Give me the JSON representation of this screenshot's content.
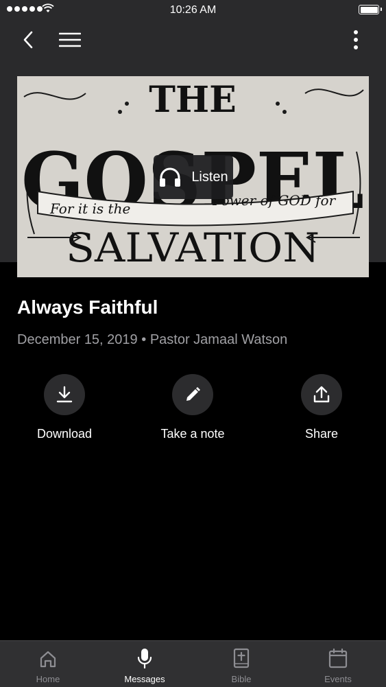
{
  "status_bar": {
    "time": "10:26 AM"
  },
  "artwork": {
    "lines": [
      "THE",
      "GOSPEL",
      "SALVATION"
    ],
    "banner_left": "For it is the",
    "banner_right": "Power of GOD for"
  },
  "listen_button": {
    "label": "Listen"
  },
  "message": {
    "title": "Always Faithful",
    "date": "December 15, 2019",
    "separator": "•",
    "speaker": "Pastor Jamaal Watson"
  },
  "actions": [
    {
      "label": "Download",
      "icon": "download-icon"
    },
    {
      "label": "Take a note",
      "icon": "pencil-icon"
    },
    {
      "label": "Share",
      "icon": "share-icon"
    }
  ],
  "tabs": [
    {
      "label": "Home",
      "icon": "home-icon"
    },
    {
      "label": "Messages",
      "icon": "microphone-icon",
      "active": true
    },
    {
      "label": "Bible",
      "icon": "bible-icon"
    },
    {
      "label": "Events",
      "icon": "calendar-icon"
    }
  ],
  "colors": {
    "header_bg": "#2a2a2c",
    "page_bg": "#000000",
    "secondary_text": "#a0a0a4",
    "tab_bar_bg": "#303032"
  }
}
